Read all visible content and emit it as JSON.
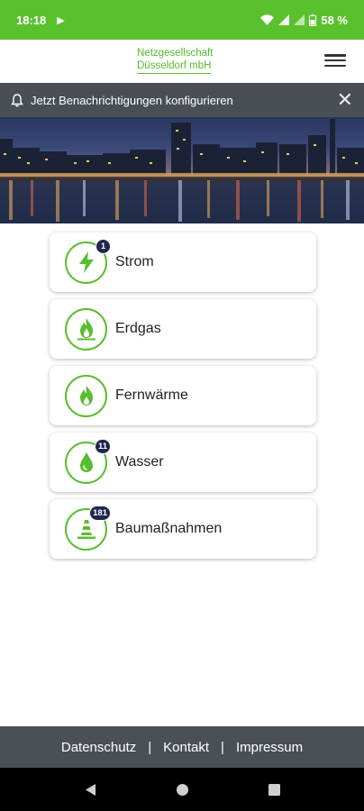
{
  "status_bar": {
    "time": "18:18",
    "battery": "58 %"
  },
  "header": {
    "logo_line1": "Netzgesellschaft",
    "logo_line2": "Düsseldorf mbH",
    "menu_icon": "hamburger-menu-icon"
  },
  "notification_banner": {
    "text": "Jetzt Benachrichtigungen konfigurieren",
    "icon": "bell-icon",
    "close_glyph": "✕"
  },
  "services": [
    {
      "label": "Strom",
      "icon": "lightning-icon",
      "badge": "1"
    },
    {
      "label": "Erdgas",
      "icon": "gas-flame-icon",
      "badge": ""
    },
    {
      "label": "Fernwärme",
      "icon": "fire-icon",
      "badge": ""
    },
    {
      "label": "Wasser",
      "icon": "water-drop-icon",
      "badge": "11"
    },
    {
      "label": "Baumaßnahmen",
      "icon": "traffic-cone-icon",
      "badge": "181"
    }
  ],
  "footer": {
    "links": [
      "Datenschutz",
      "Kontakt",
      "Impressum"
    ],
    "separator": "|"
  },
  "colors": {
    "brand_green": "#58bd2f",
    "status_bar": "#5ac12e",
    "badge": "#1d2750",
    "dark_bar": "#4b5057"
  }
}
